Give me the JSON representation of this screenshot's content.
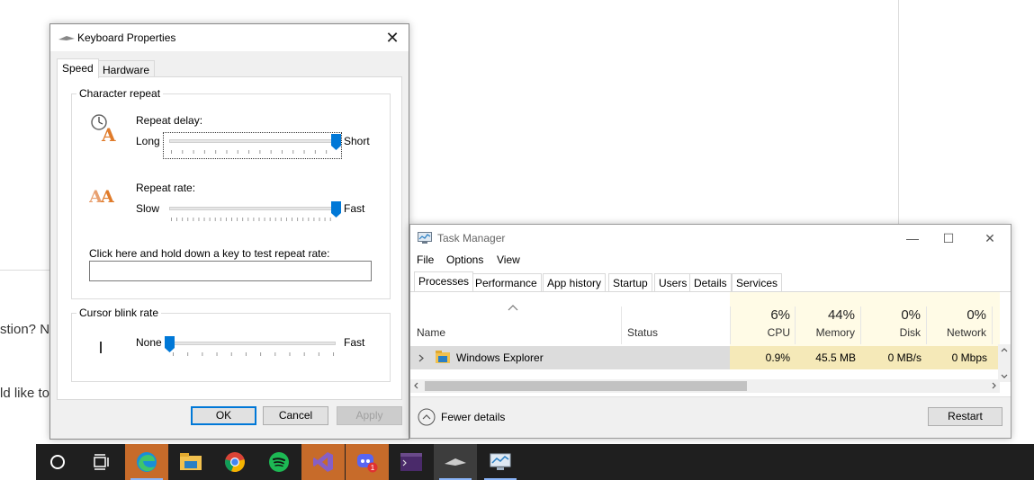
{
  "background": {
    "text_line1": "stion? No",
    "text_line2": "ld like to"
  },
  "keyboard_properties": {
    "title": "Keyboard Properties",
    "tabs": [
      "Speed",
      "Hardware"
    ],
    "character_repeat": {
      "group_label": "Character repeat",
      "repeat_delay_label": "Repeat delay:",
      "repeat_delay_min": "Long",
      "repeat_delay_max": "Short",
      "repeat_delay_value": 1.0,
      "repeat_rate_label": "Repeat rate:",
      "repeat_rate_min": "Slow",
      "repeat_rate_max": "Fast",
      "repeat_rate_value": 1.0,
      "test_label": "Click here and hold down a key to test repeat rate:",
      "test_value": ""
    },
    "cursor_blink": {
      "group_label": "Cursor blink rate",
      "min": "None",
      "max": "Fast",
      "value": 0.0
    },
    "buttons": {
      "ok": "OK",
      "cancel": "Cancel",
      "apply": "Apply"
    }
  },
  "task_manager": {
    "title": "Task Manager",
    "menu": [
      "File",
      "Options",
      "View"
    ],
    "tabs": [
      "Processes",
      "Performance",
      "App history",
      "Startup",
      "Users",
      "Details",
      "Services"
    ],
    "columns": {
      "name": "Name",
      "status": "Status",
      "cpu": {
        "pct": "6%",
        "label": "CPU"
      },
      "memory": {
        "pct": "44%",
        "label": "Memory"
      },
      "disk": {
        "pct": "0%",
        "label": "Disk"
      },
      "network": {
        "pct": "0%",
        "label": "Network"
      }
    },
    "row": {
      "name": "Windows Explorer",
      "status": "",
      "cpu": "0.9%",
      "memory": "45.5 MB",
      "disk": "0 MB/s",
      "network": "0 Mbps"
    },
    "fewer_details": "Fewer details",
    "restart": "Restart"
  },
  "taskbar": {
    "items": [
      "cortana-circle-icon",
      "task-view-icon",
      "edge-icon",
      "file-explorer-icon",
      "chrome-icon",
      "spotify-icon",
      "visual-studio-icon",
      "discord-icon",
      "terminal-icon",
      "keyboard-icon",
      "task-manager-icon"
    ],
    "discord_badge": "1"
  }
}
